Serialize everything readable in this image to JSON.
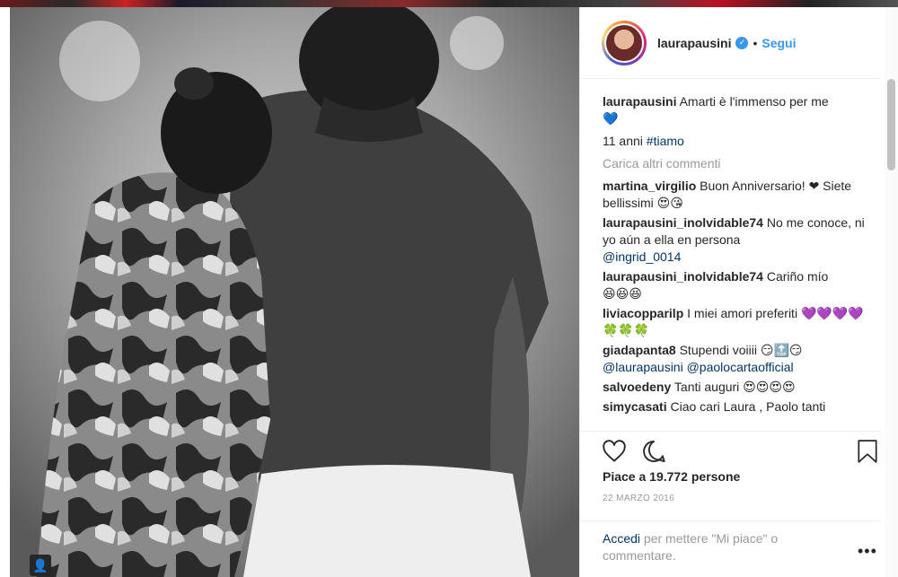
{
  "post": {
    "author": "laurapausini",
    "follow_label": "Segui",
    "dot": "•",
    "verified_icon": "verified-badge-icon"
  },
  "caption": {
    "username": "laurapausini",
    "text": "Amarti è l'immenso per me",
    "heart": "💙",
    "line2_prefix": "11 anni ",
    "hashtag": "#tiamo"
  },
  "load_more": "Carica altri commenti",
  "comments": [
    {
      "username": "martina_virgilio",
      "text": "Buon Anniversario! ❤ Siete bellissimi 😍😘"
    },
    {
      "username": "laurapausini_inolvidable74",
      "text": "No me conoce, ni yo aún a ella en persona",
      "mention": "@ingrid_0014"
    },
    {
      "username": "laurapausini_inolvidable74",
      "text": "Cariño mío",
      "emoji": "😆😆😆"
    },
    {
      "username": "liviacopparilp",
      "text": "I miei amori preferiti",
      "emoji": "💜💜💜💜🍀🍀🍀"
    },
    {
      "username": "giadapanta8",
      "text": "Stupendi voiiii 😏🔝😏",
      "mention": "@laurapausini @paolocartaofficial"
    },
    {
      "username": "salvoedeny",
      "text": "Tanti auguri 😍😍😍😍"
    },
    {
      "username": "simycasati",
      "text": "Ciao cari Laura , Paolo tanti"
    }
  ],
  "actions": {
    "like_icon": "heart-outline-icon",
    "comment_icon": "speech-bubble-icon",
    "save_icon": "bookmark-icon",
    "likes": "Piace a 19.772 persone",
    "date": "22 MARZO 2016"
  },
  "login": {
    "link": "Accedi",
    "text": " per mettere \"Mi piace\" o commentare.",
    "more": "•••"
  },
  "photo": {
    "tag_icon": "user-tag-icon"
  }
}
